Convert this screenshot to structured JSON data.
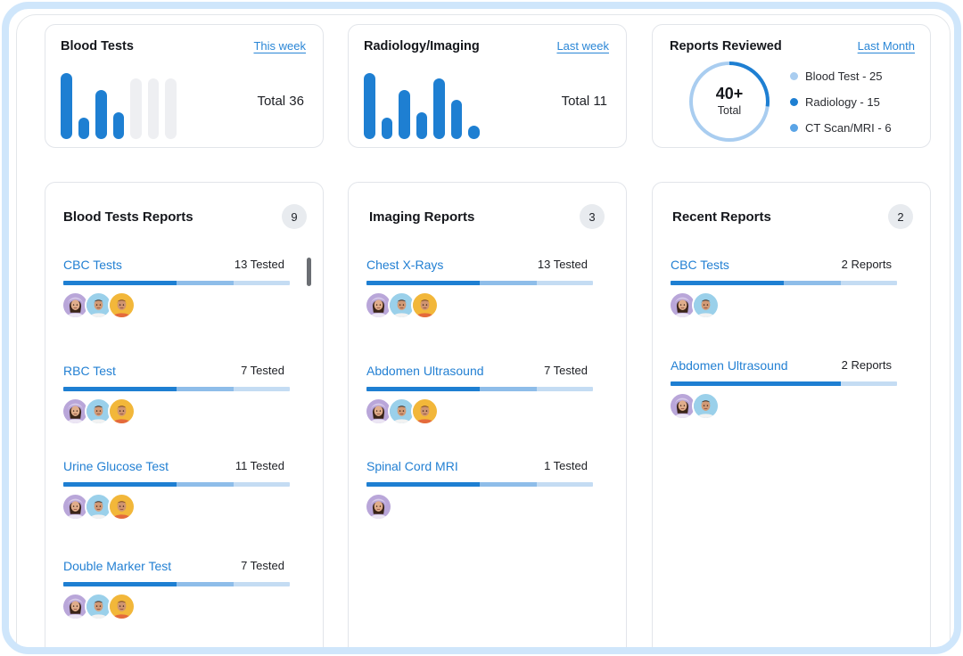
{
  "summary": {
    "blood_tests": {
      "title": "Blood Tests",
      "period": "This week",
      "total": "Total 36",
      "bar_levels": [
        1.0,
        0.33,
        0.74,
        0.41,
        0.92,
        0.92,
        0.92
      ],
      "bar_muted": [
        false,
        false,
        false,
        false,
        true,
        true,
        true
      ]
    },
    "radiology": {
      "title": "Radiology/Imaging",
      "period": "Last week",
      "total": "Total 11",
      "bar_levels": [
        1.0,
        0.32,
        0.74,
        0.41,
        0.92,
        0.59,
        0.2
      ],
      "bar_muted": [
        false,
        false,
        false,
        false,
        false,
        false,
        false
      ]
    },
    "reports_reviewed": {
      "title": "Reports Reviewed",
      "period": "Last Month",
      "ring_value": "40+",
      "ring_label": "Total",
      "ring_fill_fraction": 0.27,
      "legend": [
        {
          "label": "Blood Test - 25",
          "color": "#a9cdf0"
        },
        {
          "label": "Radiology - 15",
          "color": "#1e7fd2"
        },
        {
          "label": "CT Scan/MRI - 6",
          "color": "#5aa4e6"
        }
      ]
    }
  },
  "colors": {
    "accent": "#1e7fd2",
    "accent_mid": "#8ebde9",
    "accent_light": "#c4dcf3",
    "link": "#2380d3",
    "frame": "#cfe6fb"
  },
  "blood_reports": {
    "title": "Blood Tests Reports",
    "count": "9",
    "items": [
      {
        "name": "CBC Tests",
        "count": "13 Tested",
        "avatars": [
          "woman",
          "man-a",
          "man-b"
        ]
      },
      {
        "name": "RBC Test",
        "count": "7 Tested",
        "avatars": [
          "woman",
          "man-a",
          "man-b"
        ]
      },
      {
        "name": "Urine Glucose Test",
        "count": "11 Tested",
        "avatars": [
          "woman",
          "man-a",
          "man-b"
        ]
      },
      {
        "name": "Double Marker Test",
        "count": "7 Tested",
        "avatars": [
          "woman",
          "man-a",
          "man-b"
        ]
      }
    ]
  },
  "imaging_reports": {
    "title": "Imaging Reports",
    "count": "3",
    "items": [
      {
        "name": "Chest X-Rays",
        "count": "13 Tested",
        "avatars": [
          "woman",
          "man-a",
          "man-b"
        ]
      },
      {
        "name": "Abdomen Ultrasound",
        "count": "7 Tested",
        "avatars": [
          "woman",
          "man-a",
          "man-b"
        ]
      },
      {
        "name": "Spinal Cord MRI",
        "count": "1 Tested",
        "avatars": [
          "woman"
        ]
      }
    ]
  },
  "recent_reports": {
    "title": "Recent Reports",
    "count": "2",
    "items": [
      {
        "name": "CBC Tests",
        "count": "2 Reports",
        "avatars": [
          "woman",
          "man-a"
        ]
      },
      {
        "name": "Abdomen Ultrasound",
        "count": "2 Reports",
        "avatars": [
          "woman",
          "man-a"
        ]
      }
    ]
  }
}
